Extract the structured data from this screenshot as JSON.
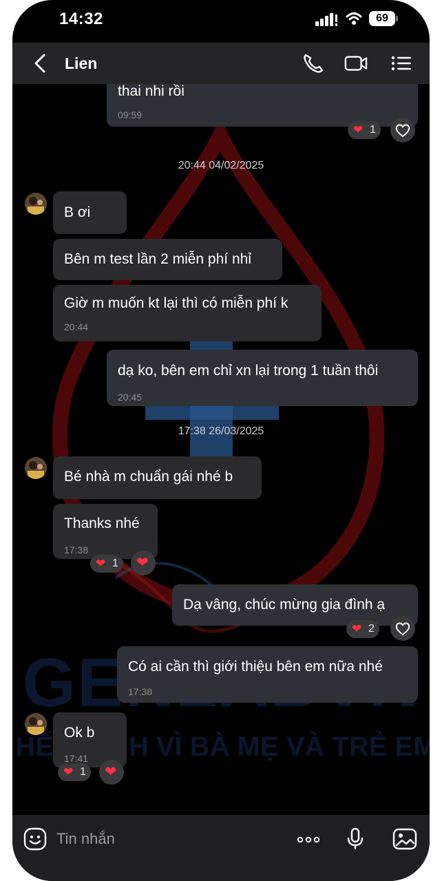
{
  "status_bar": {
    "time": "14:32",
    "battery": "69"
  },
  "header": {
    "contact_name": "Lien"
  },
  "messages": [
    {
      "dir": "out",
      "text": "thai nhi rồi",
      "time": "09:59",
      "reaction_count": "1"
    },
    {
      "timestamp": "20:44 04/02/2025"
    },
    {
      "dir": "in",
      "text": "B ơi"
    },
    {
      "dir": "in",
      "text": "Bên m test lần 2 miễn phí nhỉ"
    },
    {
      "dir": "in",
      "text": "Giờ m muốn kt lại thì có miễn phí k",
      "time": "20:44"
    },
    {
      "dir": "out",
      "text": "dạ ko, bên em chỉ xn lại trong 1 tuần thôi",
      "time": "20:45"
    },
    {
      "timestamp": "17:38 26/03/2025"
    },
    {
      "dir": "in",
      "text": "Bé nhà m chuẩn gái nhé b"
    },
    {
      "dir": "in",
      "text": "Thanks nhé",
      "time": "17:38",
      "reaction_count": "1"
    },
    {
      "dir": "out",
      "text": "Dạ vâng, chúc mừng gia đình ạ",
      "reaction_count": "2"
    },
    {
      "dir": "out",
      "text": "Có ai cần thì giới thiệu bên em nữa nhé",
      "time": "17:38"
    },
    {
      "dir": "in",
      "text": "Ok b",
      "time": "17:41",
      "reaction_count": "1"
    }
  ],
  "watermark": {
    "brand": "GENLABVN",
    "slogan": "HẾT MÌNH VÌ BÀ MẸ VÀ TRẺ EM"
  },
  "input": {
    "placeholder": "Tin nhắn"
  },
  "icons": {
    "back": "chevron-left-icon",
    "call": "phone-icon",
    "video": "video-camera-icon",
    "menu": "list-icon",
    "emoji": "smiley-icon",
    "more": "more-icon",
    "mic": "microphone-icon",
    "image": "image-icon",
    "heart": "heart-icon"
  },
  "colors": {
    "background": "#000000",
    "incoming_bubble": "#2b2b2e",
    "outgoing_bubble": "#2e3138",
    "heart": "#ff3040",
    "header": "#252528"
  }
}
